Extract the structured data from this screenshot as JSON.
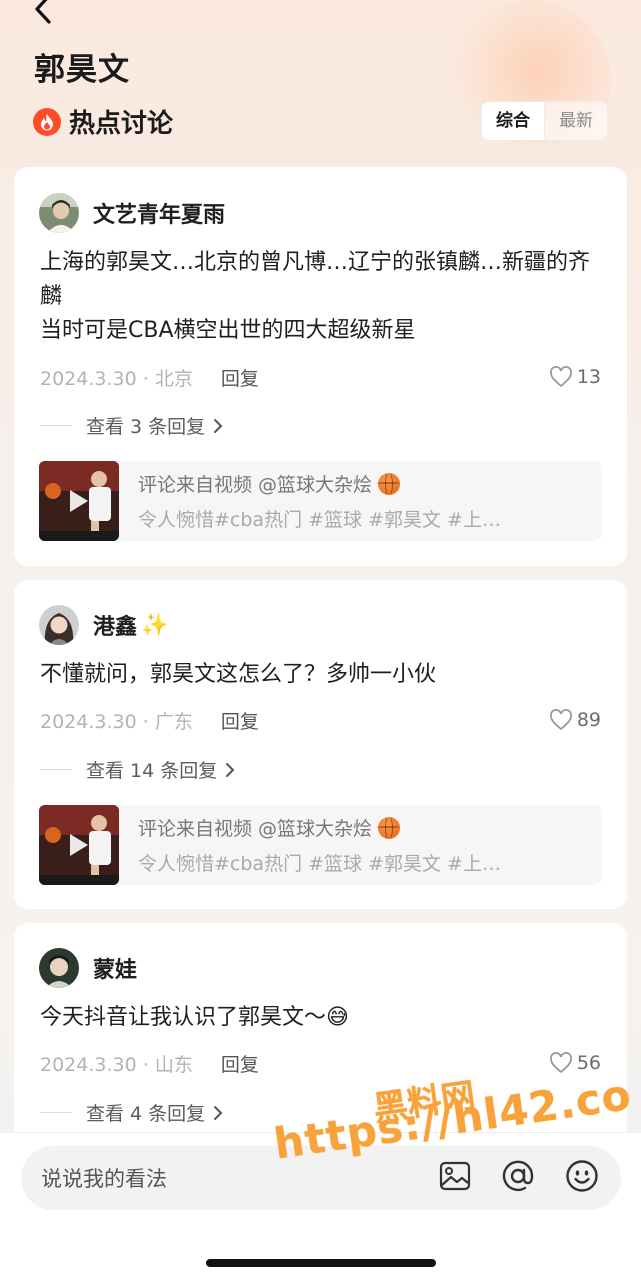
{
  "header": {
    "title": "郭昊文",
    "section_title": "热点讨论",
    "sort_tabs": [
      "综合",
      "最新"
    ]
  },
  "comments": [
    {
      "username": "文艺青年夏雨",
      "badge": "",
      "text": "上海的郭昊文…北京的曾凡博…辽宁的张镇麟…新疆的齐麟\n当时可是CBA横空出世的四大超级新星",
      "date_loc": "2024.3.30 · 北京",
      "reply_label": "回复",
      "likes": "13",
      "view_replies": "查看 3 条回复",
      "video_source": "评论来自视频 @篮球大杂烩",
      "video_tags": "令人惋惜#cba热门 #篮球 #郭昊文 #上…"
    },
    {
      "username": "港鑫",
      "badge": "✨",
      "text": "不懂就问，郭昊文这怎么了？多帅一小伙",
      "date_loc": "2024.3.30 · 广东",
      "reply_label": "回复",
      "likes": "89",
      "view_replies": "查看 14 条回复",
      "video_source": "评论来自视频 @篮球大杂烩",
      "video_tags": "令人惋惜#cba热门 #篮球 #郭昊文 #上…"
    },
    {
      "username": "蒙娃",
      "badge": "",
      "text": "今天抖音让我认识了郭昊文～",
      "text_emoji": "😅",
      "date_loc": "2024.3.30 · 山东",
      "reply_label": "回复",
      "likes": "56",
      "view_replies": "查看 4 条回复"
    }
  ],
  "composer": {
    "placeholder": "说说我的看法",
    "icons": [
      "image-icon",
      "at-icon",
      "emoji-icon"
    ]
  },
  "watermark": {
    "line1": "黑料网",
    "line2": "https://hl42.co"
  },
  "colors": {
    "accent_fire": "#ff4d2a",
    "watermark": "#f7a23b"
  }
}
